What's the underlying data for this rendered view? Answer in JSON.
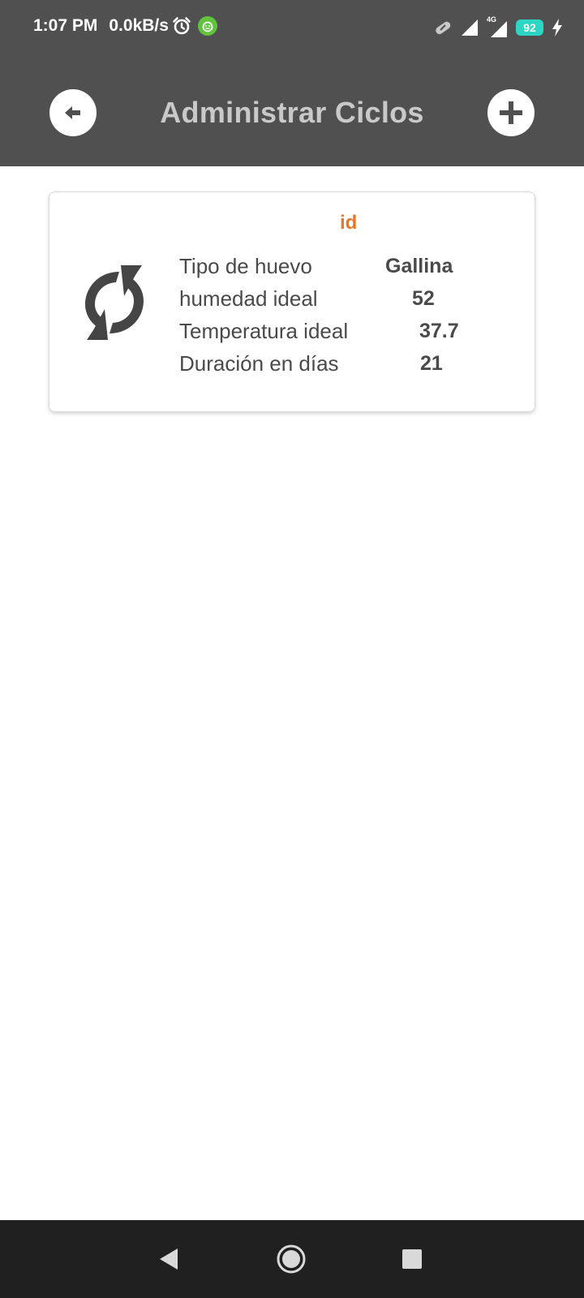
{
  "status_bar": {
    "time": "1:07 PM",
    "network_speed": "0.0kB/s",
    "battery_level": "92",
    "signal_label": "4G",
    "icons": [
      "alarm-icon",
      "app-notification-icon",
      "link-icon",
      "signal-icon",
      "signal-4g-icon",
      "battery-icon",
      "charging-icon"
    ]
  },
  "toolbar": {
    "title": "Administrar Ciclos",
    "back_icon": "arrow-left-icon",
    "add_icon": "plus-icon"
  },
  "cycle_card": {
    "id_label": "id",
    "icon": "sync-icon",
    "fields": [
      {
        "label": "Tipo de huevo",
        "value": "Gallina"
      },
      {
        "label": "humedad ideal",
        "value": "52"
      },
      {
        "label": "Temperatura ideal",
        "value": "37.7"
      },
      {
        "label": "Duración en días",
        "value": "21"
      }
    ]
  },
  "nav_bar": {
    "buttons": [
      "back-triangle-icon",
      "home-circle-icon",
      "recents-square-icon"
    ]
  },
  "colors": {
    "header_background": "#505050",
    "title_text": "#c9c9c9",
    "accent_orange": "#ec7623",
    "card_text": "#4a4a4a",
    "battery": "#2cd5c4",
    "nav_background": "#202020"
  }
}
